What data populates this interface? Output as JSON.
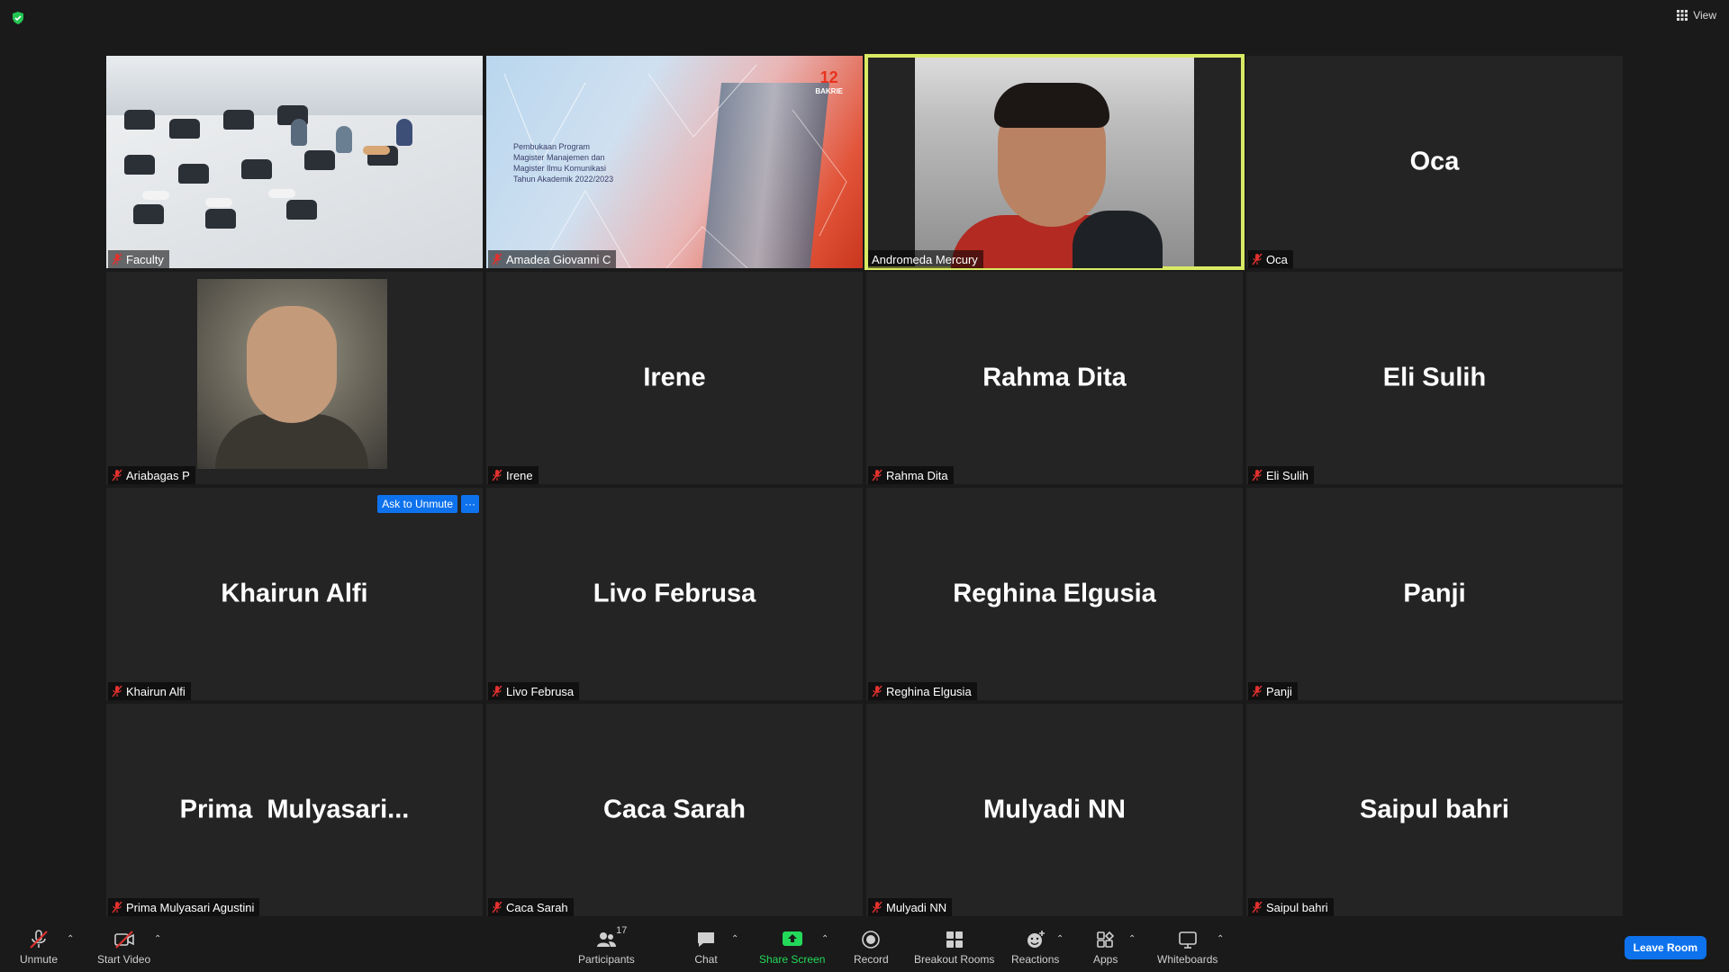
{
  "top_bar": {
    "view_label": "View"
  },
  "tiles": [
    {
      "big_name": "",
      "label": "Faculty",
      "muted": true
    },
    {
      "big_name": "",
      "label": "Amadea Giovanni C",
      "muted": true
    },
    {
      "big_name": "",
      "label": "Andromeda Mercury",
      "muted": false
    },
    {
      "big_name": "Oca",
      "label": "Oca",
      "muted": true
    },
    {
      "big_name": "",
      "label": "Ariabagas P",
      "muted": true
    },
    {
      "big_name": "Irene",
      "label": "Irene",
      "muted": true
    },
    {
      "big_name": "Rahma Dita",
      "label": "Rahma Dita",
      "muted": true
    },
    {
      "big_name": "Eli Sulih",
      "label": "Eli Sulih",
      "muted": true
    },
    {
      "big_name": "Khairun Alfi",
      "label": "Khairun Alfi",
      "muted": true
    },
    {
      "big_name": "Livo Februsa",
      "label": "Livo Februsa",
      "muted": true
    },
    {
      "big_name": "Reghina Elgusia",
      "label": "Reghina Elgusia",
      "muted": true
    },
    {
      "big_name": "Panji",
      "label": "Panji",
      "muted": true
    },
    {
      "big_name": "Prima  Mulyasari...",
      "label": "Prima Mulyasari Agustini",
      "muted": true
    },
    {
      "big_name": "Caca Sarah",
      "label": "Caca Sarah",
      "muted": true
    },
    {
      "big_name": "Mulyadi NN",
      "label": "Mulyadi NN",
      "muted": true
    },
    {
      "big_name": "Saipul bahri",
      "label": "Saipul bahri",
      "muted": true
    }
  ],
  "slide": {
    "line1": "Pembukaan Program",
    "line2": "Magister Manajemen dan",
    "line3": "Magister Ilmu Komunikasi",
    "line4": "Tahun Akademik 2022/2023",
    "logo_num": "12",
    "logo_text": "BAKRIE"
  },
  "hover_actions": {
    "ask_to_unmute": "Ask to Unmute",
    "more": "···"
  },
  "toolbar": {
    "unmute": "Unmute",
    "start_video": "Start Video",
    "participants": "Participants",
    "participants_count": "17",
    "chat": "Chat",
    "share_screen": "Share Screen",
    "record": "Record",
    "breakout_rooms": "Breakout Rooms",
    "reactions": "Reactions",
    "apps": "Apps",
    "whiteboards": "Whiteboards",
    "leave_room": "Leave Room"
  },
  "colors": {
    "active_speaker_border": "#d9ea63",
    "accent_blue": "#0e72ed",
    "share_green": "#23d959",
    "muted_red": "#e0312f"
  }
}
